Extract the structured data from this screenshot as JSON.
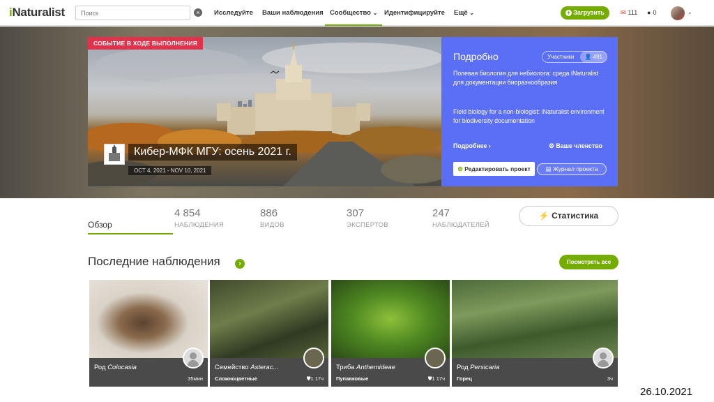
{
  "nav": {
    "logo_i": "i",
    "logo_rest": "Naturalist",
    "search_placeholder": "Поиск",
    "items": [
      {
        "label": "Исследуйте"
      },
      {
        "label": "Ваши наблюдения"
      },
      {
        "label": "Сообщество"
      },
      {
        "label": "Идентифицируйте"
      },
      {
        "label": "Ещё"
      }
    ],
    "upload_label": "Загрузить",
    "messages_count": "111",
    "notifications_count": "0",
    "colors": {
      "accent": "#74ac00"
    }
  },
  "banner": {
    "event_badge": "СОБЫТИЕ В ХОДЕ ВЫПОЛНЕНИЯ",
    "project_title": "Кибер-МФК МГУ: осень 2021 г.",
    "dates": "OCT 4, 2021 - NOV 10, 2021"
  },
  "details": {
    "title": "Подробно",
    "members_label": "Участники",
    "members_count": "491",
    "description_ru": "Полевая биология для небиолога: среда iNaturalist для документации биоразнообразия",
    "description_en": "Field biology for a non-biologist: iNaturalist environment for biodiversity documentation",
    "more_link": "Подробнее ›",
    "membership_link": "Ваше членство",
    "edit_button": "Редактировать проект",
    "journal_button": "Журнал проекта",
    "color": "#5b6ef6"
  },
  "stats": {
    "overview_tab": "Обзор",
    "items": [
      {
        "num": "4 854",
        "label": "НАБЛЮДЕНИЯ"
      },
      {
        "num": "886",
        "label": "ВИДОВ"
      },
      {
        "num": "307",
        "label": "ЭКСПЕРТОВ"
      },
      {
        "num": "247",
        "label": "НАБЛЮДАТЕЛЕЙ"
      }
    ],
    "stats_button": "Статистика"
  },
  "recent": {
    "title": "Последние наблюдения",
    "view_all": "Посмотреть все",
    "observations": [
      {
        "rank": "Род ",
        "name": "Colocasia",
        "common": "",
        "when": "35мин"
      },
      {
        "rank": "Семейство ",
        "name": "Asterac...",
        "common": "Сложноцветные",
        "when": "1 17ч"
      },
      {
        "rank": "Триба ",
        "name": "Anthemideae",
        "common": "Пупавковые",
        "when": "1 17ч"
      },
      {
        "rank": "Род ",
        "name": "Persicaria",
        "common": "Горец",
        "when": "3ч"
      }
    ]
  },
  "footer": {
    "date_stamp": "26.10.2021"
  }
}
